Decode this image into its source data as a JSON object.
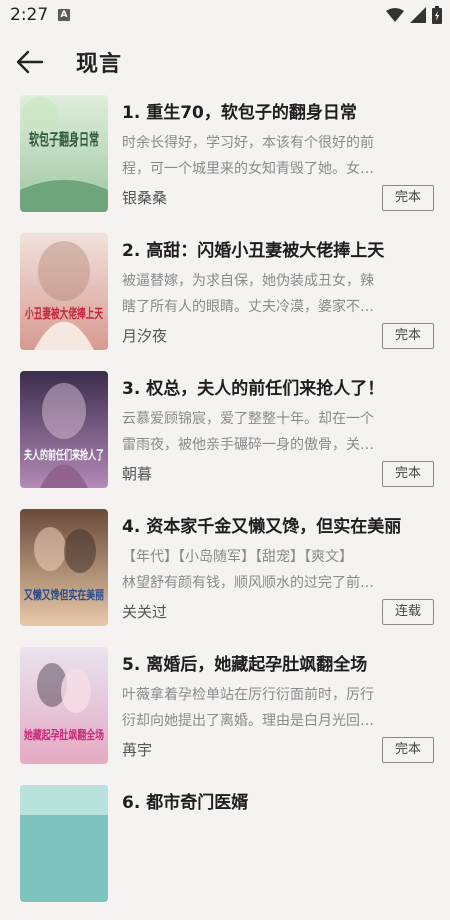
{
  "status_bar": {
    "time": "2:27",
    "notification_icon": "A",
    "icons": [
      "wifi-icon",
      "signal-icon",
      "battery-icon"
    ]
  },
  "header": {
    "back_icon": "arrow-left-icon",
    "title": "现言"
  },
  "books": [
    {
      "title": "1. 重生70，软包子的翻身日常",
      "desc_line1": "时余长得好，学习好，本该有个很好的前",
      "desc_line2": "程，可一个城里来的女知青毁了她。女…",
      "author": "银桑桑",
      "status": "完本",
      "cover_text": "软包子翻身日常"
    },
    {
      "title": "2. 高甜：闪婚小丑妻被大佬捧上天",
      "desc_line1": "被逼替嫁，为求自保，她伪装成丑女，辣",
      "desc_line2": "瞎了所有人的眼睛。丈夫冷漠，婆家不…",
      "author": "月汐夜",
      "status": "完本",
      "cover_text": "小丑妻被大佬捧上天"
    },
    {
      "title": "3. 权总，夫人的前任们来抢人了！",
      "desc_line1": "云慕爱顾锦宸，爱了整整十年。却在一个",
      "desc_line2": "雷雨夜，被他亲手碾碎一身的傲骨，关…",
      "author": "朝暮",
      "status": "完本",
      "cover_text": "夫人的前任们来抢人了"
    },
    {
      "title": "4. 资本家千金又懒又馋，但实在美丽",
      "desc_line1": "【年代】【小岛随军】【甜宠】【爽文】",
      "desc_line2": "林望舒有颜有钱，顺风顺水的过完了前…",
      "author": "关关过",
      "status": "连载",
      "cover_text": "又懒又馋但实在美丽"
    },
    {
      "title": "5. 离婚后，她藏起孕肚飒翻全场",
      "desc_line1": "叶薇拿着孕检单站在厉行衍面前时，厉行",
      "desc_line2": "衍却向她提出了离婚。理由是白月光回…",
      "author": "苒宇",
      "status": "完本",
      "cover_text": "她藏起孕肚飒翻全场"
    },
    {
      "title": "6. 都市奇门医婿",
      "desc_line1": "",
      "desc_line2": "",
      "author": "",
      "status": "",
      "cover_text": ""
    }
  ],
  "colors": {
    "background": "#f7f2f2",
    "title": "#1e1e1e",
    "desc": "#8a8a8a",
    "tag_border": "#8a8a8a"
  }
}
